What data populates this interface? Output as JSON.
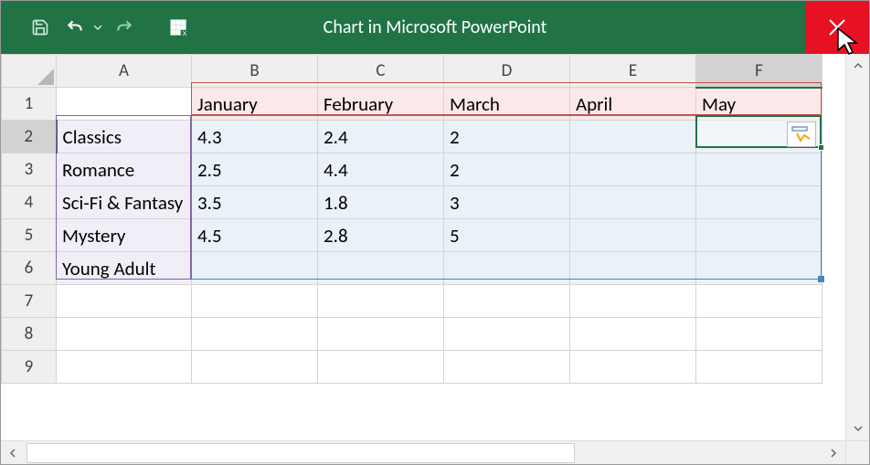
{
  "window": {
    "title": "Chart in Microsoft PowerPoint"
  },
  "columns": [
    "A",
    "B",
    "C",
    "D",
    "E",
    "F"
  ],
  "rows": [
    "1",
    "2",
    "3",
    "4",
    "5",
    "6",
    "7",
    "8",
    "9"
  ],
  "headers": {
    "B": "January",
    "C": "February",
    "D": "March",
    "E": "April",
    "F": "May"
  },
  "categories": {
    "2": "Classics",
    "3": "Romance",
    "4": "Sci-Fi & Fantasy",
    "5": "Mystery",
    "6": "Young Adult"
  },
  "values": {
    "2": {
      "B": "4.3",
      "C": "2.4",
      "D": "2"
    },
    "3": {
      "B": "2.5",
      "C": "4.4",
      "D": "2"
    },
    "4": {
      "B": "3.5",
      "C": "1.8",
      "D": "3"
    },
    "5": {
      "B": "4.5",
      "C": "2.8",
      "D": "5"
    }
  },
  "active_cell": "F2",
  "chart_data": {
    "type": "bar",
    "categories": [
      "Classics",
      "Romance",
      "Sci-Fi & Fantasy",
      "Mystery",
      "Young Adult"
    ],
    "series": [
      {
        "name": "January",
        "values": [
          4.3,
          2.5,
          3.5,
          4.5,
          null
        ]
      },
      {
        "name": "February",
        "values": [
          2.4,
          4.4,
          1.8,
          2.8,
          null
        ]
      },
      {
        "name": "March",
        "values": [
          2,
          2,
          3,
          5,
          null
        ]
      },
      {
        "name": "April",
        "values": [
          null,
          null,
          null,
          null,
          null
        ]
      },
      {
        "name": "May",
        "values": [
          null,
          null,
          null,
          null,
          null
        ]
      }
    ],
    "title": "",
    "xlabel": "",
    "ylabel": ""
  }
}
